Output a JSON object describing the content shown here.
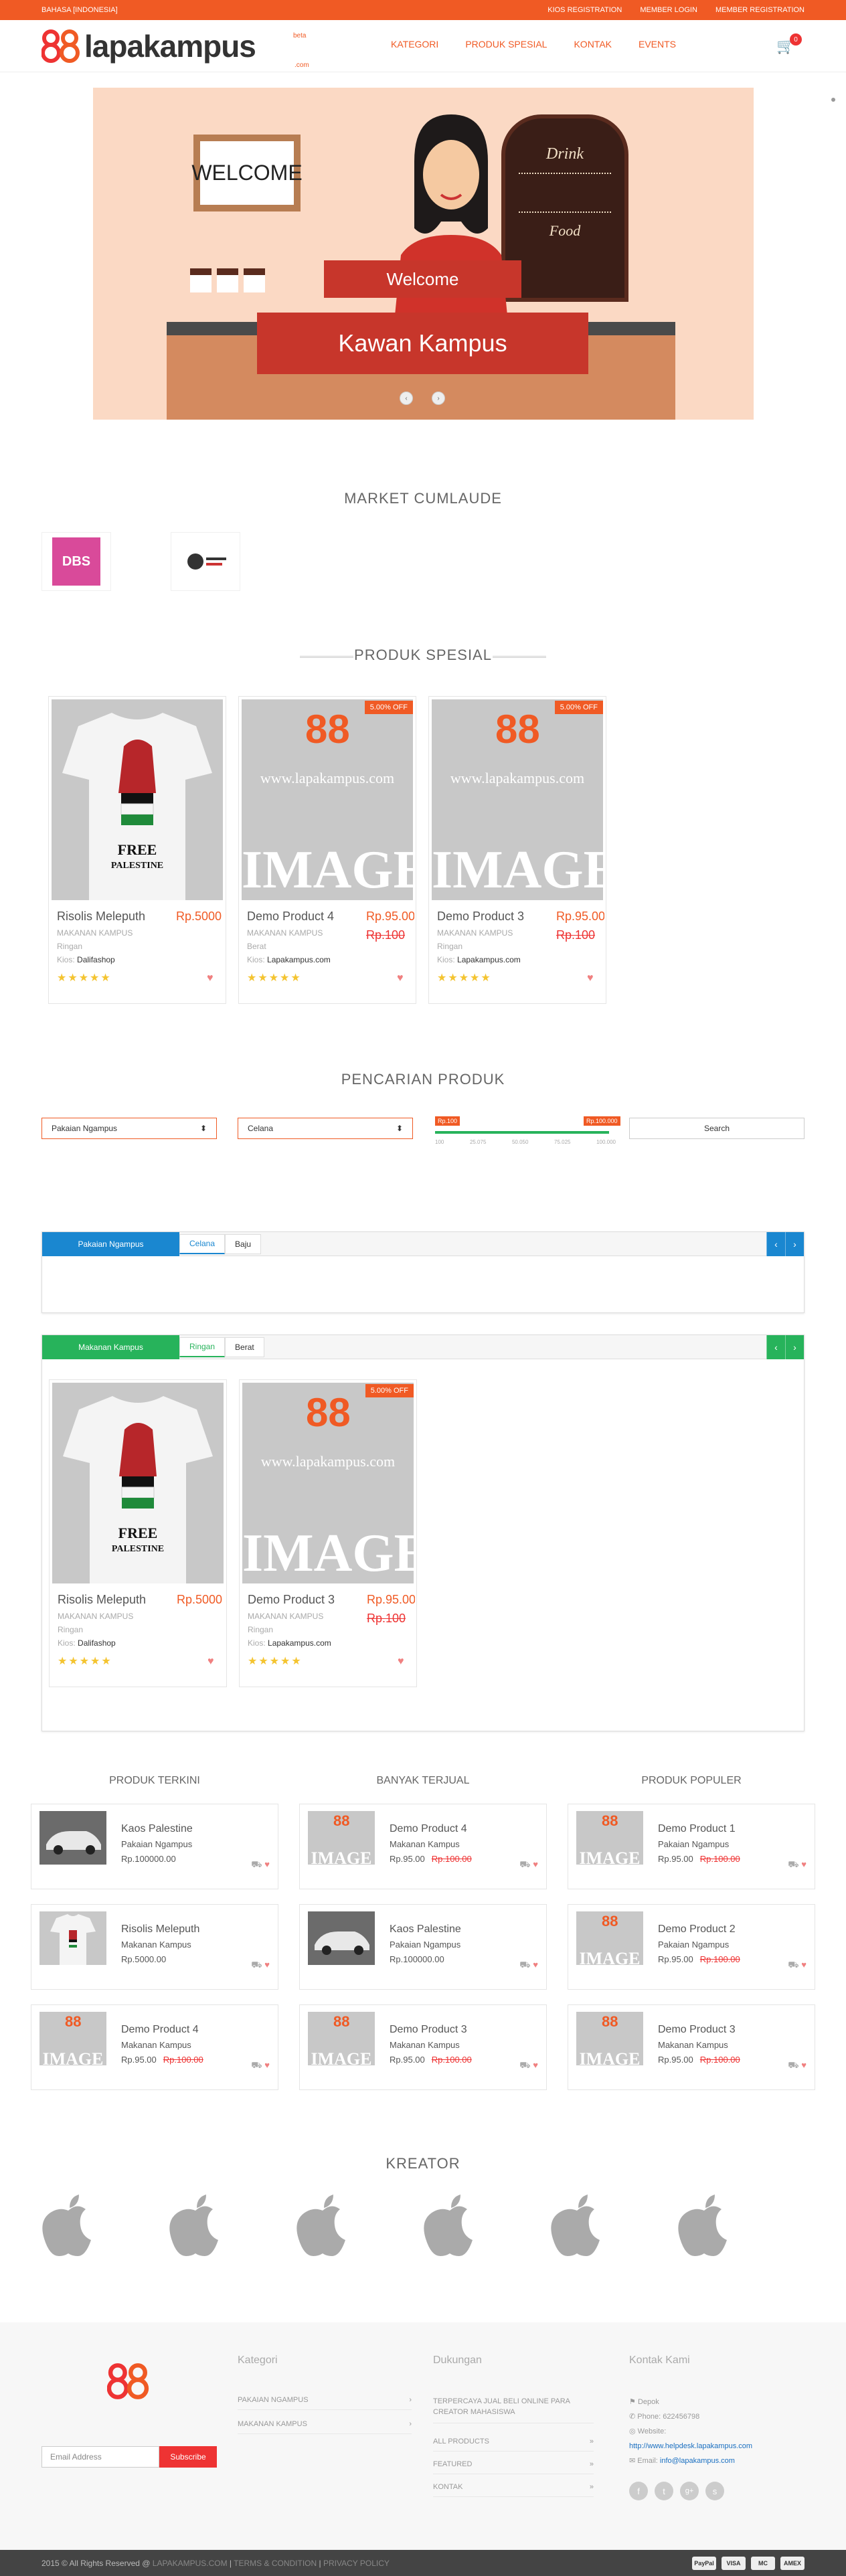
{
  "topbar": {
    "language": "BAHASA [INDONESIA]",
    "links": [
      "KIOS REGISTRATION",
      "MEMBER LOGIN",
      "MEMBER REGISTRATION"
    ]
  },
  "header": {
    "logo_text": "lapakampus",
    "beta": "beta",
    "dotcom": ".com",
    "nav": [
      "KATEGORI",
      "PRODUK SPESIAL",
      "KONTAK",
      "EVENTS"
    ],
    "cart_count": "0"
  },
  "slider": {
    "sign": "WELCOME",
    "menu_title": "Drink",
    "menu_sub": "Food",
    "line1": "Welcome",
    "line2": "Kawan Kampus"
  },
  "market": {
    "title": "MARKET CUMLAUDE",
    "brand1": "DBS"
  },
  "special": {
    "title": "PRODUK SPESIAL",
    "products": [
      {
        "name": "Risolis Meleputh",
        "price": "Rp.5000",
        "old": "",
        "cat": "MAKANAN KAMPUS",
        "var": "Ringan",
        "kios_label": "Kios:",
        "kios": "Dalifashop",
        "off": ""
      },
      {
        "name": "Demo Product 4",
        "price": "Rp.95.000",
        "old": "Rp.100",
        "cat": "MAKANAN KAMPUS",
        "var": "Berat",
        "kios_label": "Kios:",
        "kios": "Lapakampus.com",
        "off": "5.00% OFF"
      },
      {
        "name": "Demo Product 3",
        "price": "Rp.95.000",
        "old": "Rp.100",
        "cat": "MAKANAN KAMPUS",
        "var": "Ringan",
        "kios_label": "Kios:",
        "kios": "Lapakampus.com",
        "off": "5.00% OFF"
      }
    ],
    "placeholder_url": "www.lapakampus.com",
    "placeholder_img": "IMAGE",
    "shirt_text": "FREE PALESTINE"
  },
  "search": {
    "title": "PENCARIAN PRODUK",
    "category": "Pakaian Ngampus",
    "subcategory": "Celana",
    "price_min": "Rp.100",
    "price_max": "Rp.100.000",
    "ticks": [
      "100",
      "25.075",
      "50.050",
      "75.025",
      "100.000"
    ],
    "button": "Search"
  },
  "tabs1": {
    "main": "Pakaian Ngampus",
    "tabs": [
      "Celana",
      "Baju"
    ],
    "color": "#1a87d0"
  },
  "tabs2": {
    "main": "Makanan Kampus",
    "tabs": [
      "Ringan",
      "Berat"
    ],
    "color": "#27b35b",
    "products": [
      {
        "name": "Risolis Meleputh",
        "price": "Rp.5000",
        "old": "",
        "cat": "MAKANAN KAMPUS",
        "var": "Ringan",
        "kios_label": "Kios:",
        "kios": "Dalifashop",
        "off": ""
      },
      {
        "name": "Demo Product 3",
        "price": "Rp.95.000",
        "old": "Rp.100",
        "cat": "MAKANAN KAMPUS",
        "var": "Ringan",
        "kios_label": "Kios:",
        "kios": "Lapakampus.com",
        "off": "5.00% OFF"
      }
    ]
  },
  "lists": {
    "titles": [
      "PRODUK TERKINI",
      "BANYAK TERJUAL",
      "PRODUK POPULER"
    ],
    "columns": [
      [
        {
          "name": "Kaos Palestine",
          "cat": "Pakaian Ngampus",
          "price": "Rp.100000.00",
          "old": ""
        },
        {
          "name": "Risolis Meleputh",
          "cat": "Makanan Kampus",
          "price": "Rp.5000.00",
          "old": ""
        },
        {
          "name": "Demo Product 4",
          "cat": "Makanan Kampus",
          "price": "Rp.95.00",
          "old": "Rp.100.00"
        }
      ],
      [
        {
          "name": "Demo Product 4",
          "cat": "Makanan Kampus",
          "price": "Rp.95.00",
          "old": "Rp.100.00"
        },
        {
          "name": "Kaos Palestine",
          "cat": "Pakaian Ngampus",
          "price": "Rp.100000.00",
          "old": ""
        },
        {
          "name": "Demo Product 3",
          "cat": "Makanan Kampus",
          "price": "Rp.95.00",
          "old": "Rp.100.00"
        }
      ],
      [
        {
          "name": "Demo Product 1",
          "cat": "Pakaian Ngampus",
          "price": "Rp.95.00",
          "old": "Rp.100.00"
        },
        {
          "name": "Demo Product 2",
          "cat": "Pakaian Ngampus",
          "price": "Rp.95.00",
          "old": "Rp.100.00"
        },
        {
          "name": "Demo Product 3",
          "cat": "Makanan Kampus",
          "price": "Rp.95.00",
          "old": "Rp.100.00"
        }
      ]
    ]
  },
  "kreator": {
    "title": "KREATOR"
  },
  "footer": {
    "email_placeholder": "Email Address",
    "subscribe": "Subscribe",
    "kategori_title": "Kategori",
    "kategori": [
      "PAKAIAN NGAMPUS",
      "MAKANAN KAMPUS"
    ],
    "dukungan_title": "Dukungan",
    "dukungan": [
      "TERPERCAYA JUAL BELI ONLINE PARA CREATOR MAHASISWA",
      "ALL PRODUCTS",
      "FEATURED",
      "KONTAK"
    ],
    "kontak_title": "Kontak Kami",
    "address": "Depok",
    "phone": "Phone: 622456798",
    "website_label": "Website:",
    "website": "http://www.helpdesk.lapakampus.com",
    "email_label": "Email:",
    "email": "info@lapakampus.com",
    "copyright": "2015 © All Rights Reserved @",
    "copyright_link": "LAPAKAMPUS.COM",
    "terms": "TERMS & CONDITION",
    "privacy": "PRIVACY POLICY",
    "pay": [
      "PayPal",
      "VISA",
      "MC",
      "AMEX"
    ]
  }
}
